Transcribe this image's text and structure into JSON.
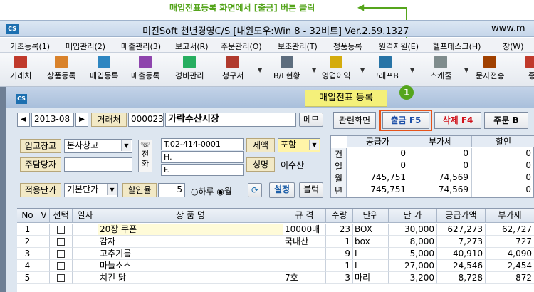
{
  "callout": {
    "text": "매입전표등록 화면에서 [출금] 버튼 클릭",
    "step": "1"
  },
  "window": {
    "logo": "CS",
    "title": "미진Soft 천년경영C/S [내윈도우:Win 8 - 32비트] Ver.2.59.1327",
    "right_text": "www.m"
  },
  "menu": [
    "기초등록(1)",
    "매입관리(2)",
    "매출관리(3)",
    "보고서(R)",
    "주문관리(O)",
    "보조관리(T)",
    "정품등록",
    "원격지원(E)",
    "헬프데스크(H)",
    "창(W)"
  ],
  "toolbar": [
    {
      "label": "거래처",
      "icon": "partner-icon",
      "color": "#c0392b"
    },
    {
      "label": "상품등록",
      "icon": "product-icon",
      "color": "#d9822b"
    },
    {
      "label": "매입등록",
      "icon": "purchase-icon",
      "color": "#2e86c1"
    },
    {
      "label": "매출등록",
      "icon": "sales-icon",
      "color": "#8e44ad"
    },
    {
      "label": "경비관리",
      "icon": "expense-icon",
      "color": "#27ae60"
    },
    {
      "label": "청구서",
      "icon": "invoice-icon",
      "color": "#b03a2e"
    },
    {
      "label": "B/L현황",
      "icon": "bl-icon",
      "color": "#5d6d7e"
    },
    {
      "label": "영업이익",
      "icon": "profit-icon",
      "color": "#d4ac0d"
    },
    {
      "label": "그래프B",
      "icon": "chart-icon",
      "color": "#2874a6"
    },
    {
      "label": "스케줄",
      "icon": "calendar-icon",
      "color": "#7f8c8d"
    },
    {
      "label": "문자전송",
      "icon": "sms-icon",
      "color": "#a04000"
    },
    {
      "label": "종",
      "icon": "exit-icon",
      "color": "#c0392b"
    }
  ],
  "child": {
    "logo": "CS",
    "title": "매입전표 등록"
  },
  "buttons": {
    "related": "관련화면",
    "withdraw": "출금 F5",
    "delete": "삭제 F4",
    "order": "주문 B"
  },
  "form": {
    "date": "2013-08",
    "partner_label": "거래처",
    "partner_code": "000023",
    "partner_name": "가락수산시장",
    "memo": "메모",
    "warehouse_label": "입고창고",
    "warehouse_value": "본사창고",
    "manager_label": "주담당자",
    "manager_value": "",
    "phone_label": "전화",
    "tel": "T.02-414-0001",
    "hp": "H.",
    "fax": "F.",
    "tax_label": "세액",
    "tax_value": "포함",
    "name_label": "성명",
    "name_value": "이수산",
    "price_label": "적용단가",
    "price_value": "기본단가",
    "discount_label": "할인율",
    "discount_value": "5",
    "radio_day": "하루",
    "radio_month": "월",
    "settings": "설정",
    "block": "블럭"
  },
  "summary": {
    "headers": [
      "공급가",
      "부가세",
      "할인"
    ],
    "rows": [
      {
        "label": "건",
        "supply": "0",
        "vat": "0",
        "discount": "0"
      },
      {
        "label": "일",
        "supply": "0",
        "vat": "0",
        "discount": "0"
      },
      {
        "label": "월",
        "supply": "745,751",
        "vat": "74,569",
        "discount": "0"
      },
      {
        "label": "년",
        "supply": "745,751",
        "vat": "74,569",
        "discount": "0"
      }
    ]
  },
  "grid": {
    "headers": [
      "No",
      "V",
      "선택",
      "일자",
      "상 품 명",
      "규 격",
      "수량",
      "단위",
      "단 가",
      "공급가액",
      "부가세"
    ],
    "rows": [
      {
        "no": "1",
        "name": "20장 쿠폰",
        "spec": "10000매",
        "qty": "23",
        "unit": "BOX",
        "price": "30,000",
        "supply": "627,273",
        "vat": "62,727"
      },
      {
        "no": "2",
        "name": "감자",
        "spec": "국내산",
        "qty": "1",
        "unit": "box",
        "price": "8,000",
        "supply": "7,273",
        "vat": "727"
      },
      {
        "no": "3",
        "name": "고추기름",
        "spec": "",
        "qty": "9",
        "unit": "L",
        "price": "5,000",
        "supply": "40,910",
        "vat": "4,090"
      },
      {
        "no": "4",
        "name": "마늘소스",
        "spec": "",
        "qty": "1",
        "unit": "L",
        "price": "27,000",
        "supply": "24,546",
        "vat": "2,454"
      },
      {
        "no": "5",
        "name": "치킨 닭",
        "spec": "7호",
        "qty": "3",
        "unit": "마리",
        "price": "3,200",
        "supply": "8,728",
        "vat": "872"
      }
    ]
  },
  "colors": {
    "accent_green": "#55a51c",
    "highlight_red": "#e5531a",
    "title_yellow": "#f4f07a"
  }
}
